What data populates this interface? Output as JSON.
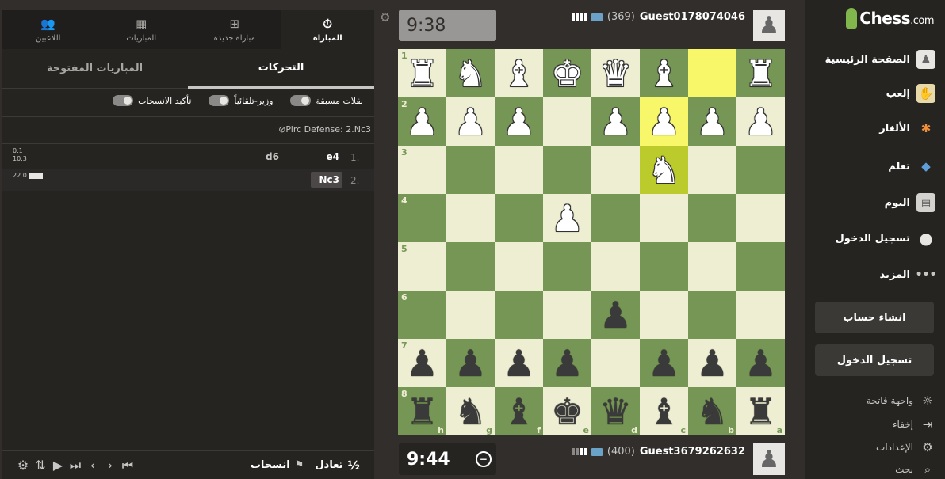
{
  "sidebar": {
    "brand": "Chess",
    "brand_suffix": ".com",
    "items": [
      {
        "label": "الصفحة الرئيسية",
        "icon": "home-pawn-icon"
      },
      {
        "label": "إلعب",
        "icon": "play-hand-icon"
      },
      {
        "label": "الألغاز",
        "icon": "puzzle-icon"
      },
      {
        "label": "تعلم",
        "icon": "graduation-cap-icon"
      },
      {
        "label": "اليوم",
        "icon": "newspaper-icon"
      },
      {
        "label": "تسجيل الدخول",
        "icon": "chat-bubble-icon"
      },
      {
        "label": "المزيد",
        "icon": "more-dots-icon"
      }
    ],
    "signup_label": "انشاء حساب",
    "login_label": "تسجيل الدخول",
    "bottom": [
      {
        "label": "واجهة فاتحة",
        "icon": "sun-icon"
      },
      {
        "label": "إخفاء",
        "icon": "collapse-icon"
      },
      {
        "label": "الإعدادات",
        "icon": "gear-icon"
      },
      {
        "label": "بحث",
        "icon": "search-icon"
      }
    ]
  },
  "players": {
    "top": {
      "name": "Guest0178074046",
      "rating": "(369)",
      "clock": "9:38"
    },
    "bottom": {
      "name": "Guest3679262632",
      "rating": "(400)",
      "clock": "9:44"
    }
  },
  "board": {
    "rank_labels": [
      "1",
      "2",
      "3",
      "4",
      "5",
      "6",
      "7",
      "8"
    ],
    "file_labels": [
      "h",
      "g",
      "f",
      "e",
      "d",
      "c",
      "b",
      "a"
    ],
    "rows": [
      [
        "wR",
        "wN",
        "wB",
        "wK",
        "wQ",
        "wB",
        "",
        "wR"
      ],
      [
        "wP",
        "wP",
        "wP",
        "",
        "wP",
        "wP",
        "wP",
        "wP"
      ],
      [
        "",
        "",
        "",
        "",
        "",
        "wN",
        "",
        ""
      ],
      [
        "",
        "",
        "",
        "wP",
        "",
        "",
        "",
        ""
      ],
      [
        "",
        "",
        "",
        "",
        "",
        "",
        "",
        ""
      ],
      [
        "",
        "",
        "",
        "",
        "bP",
        "",
        "",
        ""
      ],
      [
        "bP",
        "bP",
        "bP",
        "bP",
        "",
        "bP",
        "bP",
        "bP"
      ],
      [
        "bR",
        "bN",
        "bB",
        "bK",
        "bQ",
        "bB",
        "bN",
        "bR"
      ]
    ],
    "highlights": [
      [
        0,
        6
      ],
      [
        1,
        5
      ],
      [
        2,
        5
      ]
    ]
  },
  "panel": {
    "top_tabs": [
      {
        "label": "المباراة",
        "icon": "stopwatch-icon",
        "active": true
      },
      {
        "label": "مباراة جديدة",
        "icon": "plus-square-icon",
        "active": false
      },
      {
        "label": "المباريات",
        "icon": "checkerboard-icon",
        "active": false
      },
      {
        "label": "اللاعبين",
        "icon": "players-icon",
        "active": false
      }
    ],
    "sub_tabs": [
      {
        "label": "التحركات",
        "active": true
      },
      {
        "label": "المباريات المفتوحة",
        "active": false
      }
    ],
    "toggles": [
      {
        "label": "نقلات مسبقة"
      },
      {
        "label": "وزير-تلقائياً"
      },
      {
        "label": "تأكيد الانسحاب"
      }
    ],
    "opening": "Pirc Defense: 2.Nc3",
    "moves": [
      {
        "num": "1.",
        "white": "e4",
        "black": "d6",
        "eval_top": "0.1",
        "eval_bottom": "10.3"
      },
      {
        "num": "2.",
        "white": "Nc3",
        "black": "",
        "eval_top": "22.0",
        "eval_bottom": ""
      }
    ],
    "footer": {
      "draw_label": "تعادل",
      "draw_icon_text": "½",
      "resign_label": "انسحاب"
    }
  }
}
